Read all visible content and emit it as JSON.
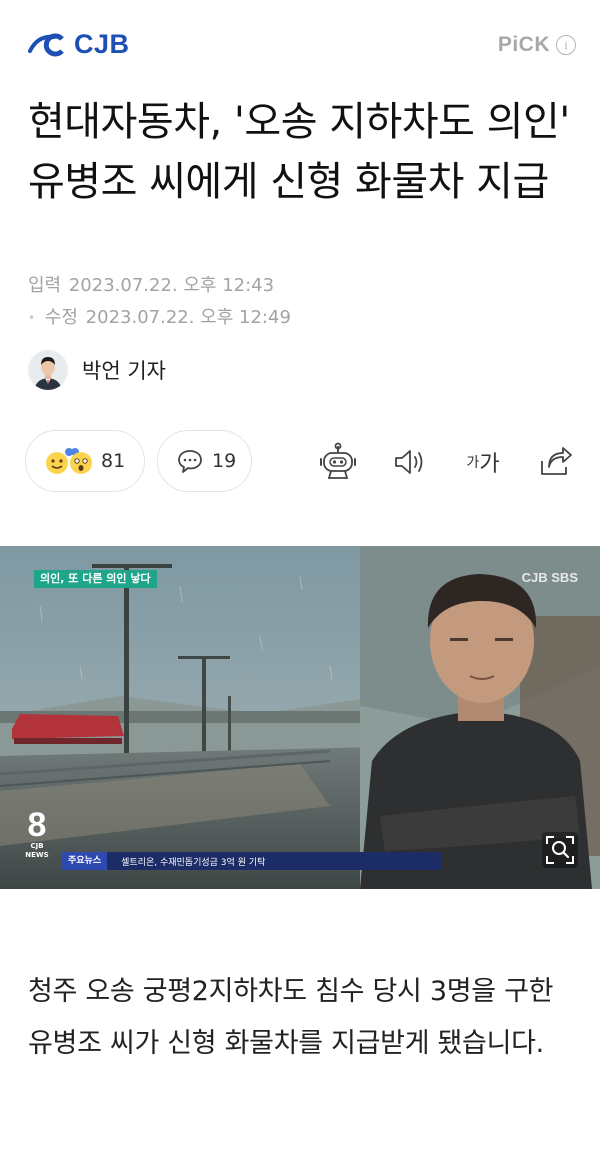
{
  "header": {
    "logo_text": "CJB",
    "pick_label": "PiCK",
    "info_label": "i"
  },
  "article": {
    "title": "현대자동차, '오송 지하차도 의인' 유병조 씨에게 신형 화물차 지급",
    "published_label": "입력",
    "published": "2023.07.22. 오후 12:43",
    "modified_label": "수정",
    "modified": "2023.07.22. 오후 12:49",
    "reporter": "박언 기자",
    "body": "청주 오송 궁평2지하차도 침수 당시 3명을 구한 유병조 씨가 신형 화물차를 지급받게 됐습니다."
  },
  "actions": {
    "reaction_count": "81",
    "comment_count": "19",
    "font_small": "가",
    "font_large": "가"
  },
  "video": {
    "banner_text": "의인, 또 다른 의인 낳다",
    "broadcaster": "CJB SBS",
    "channel_number": "8",
    "channel_logo": "CJB NEWS",
    "ticker_label": "주요뉴스",
    "ticker_text": "셀트리온, 수재민돕기성금 3억 원 기탁"
  },
  "colors": {
    "brand_blue": "#1d4fb5",
    "muted_text": "#a3a3a3",
    "ticker_bg": "#1c2c66",
    "banner_bg": "#1fa58a"
  },
  "icons": [
    "cjb-logo-icon",
    "info-icon",
    "reaction-emoji-icon",
    "comment-icon",
    "tts-robot-icon",
    "speaker-icon",
    "font-size-icon",
    "share-icon",
    "zoom-icon"
  ]
}
